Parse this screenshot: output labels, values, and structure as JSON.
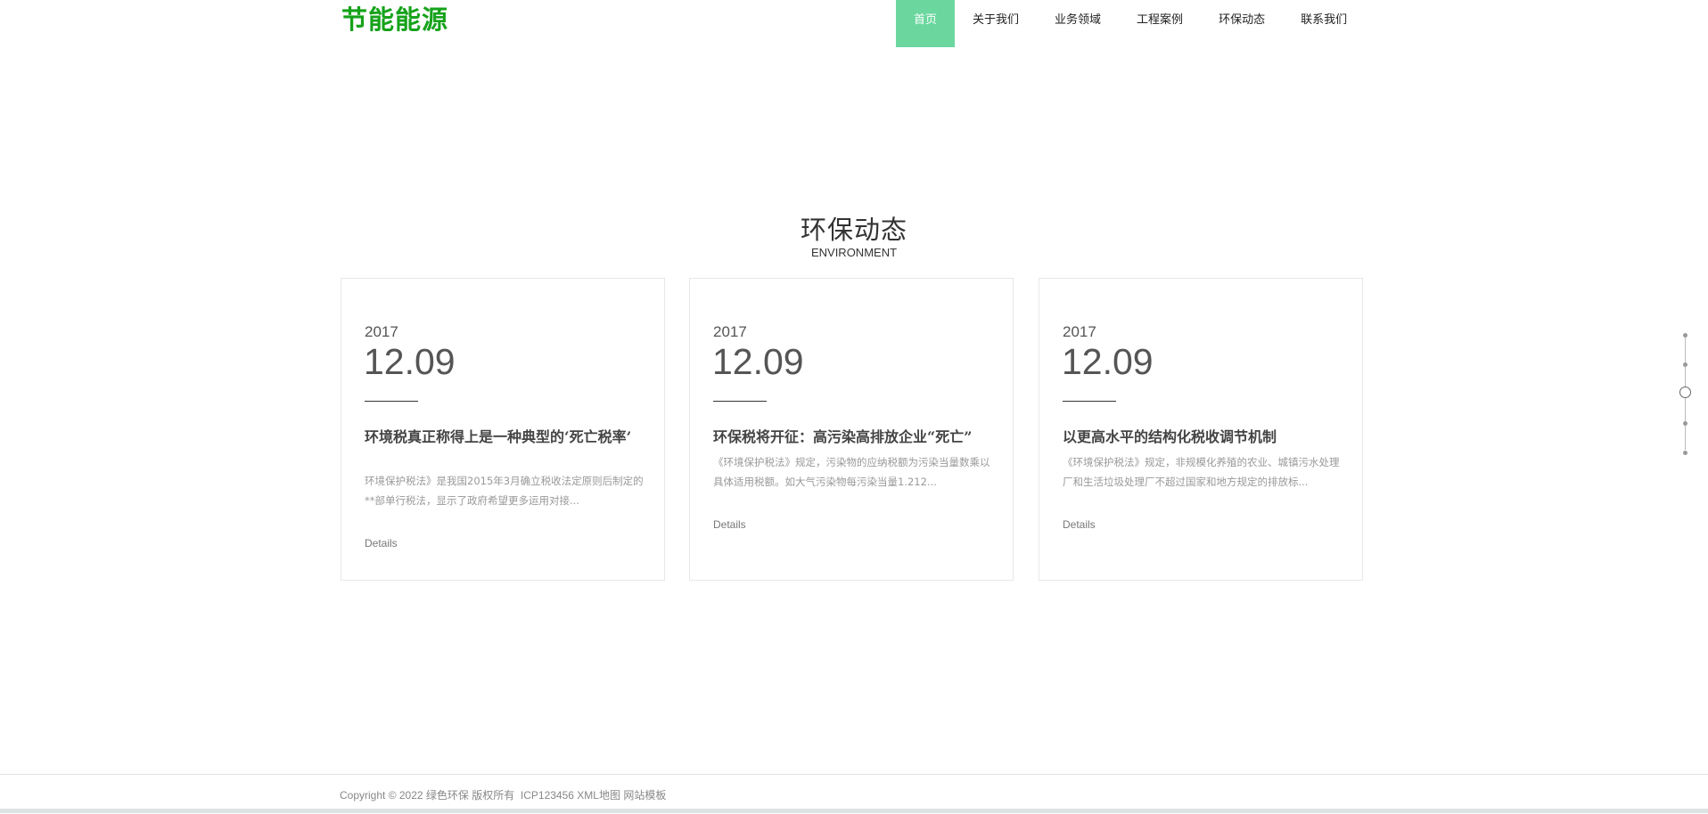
{
  "header": {
    "logo": "节能能源",
    "nav": [
      {
        "label": "首页",
        "active": true
      },
      {
        "label": "关于我们"
      },
      {
        "label": "业务领域"
      },
      {
        "label": "工程案例"
      },
      {
        "label": "环保动态"
      },
      {
        "label": "联系我们"
      }
    ],
    "active_color": "#6bd79f",
    "logo_color": "#16a21b"
  },
  "section": {
    "title": "环保动态",
    "subtitle": "ENVIRONMENT"
  },
  "cards": [
    {
      "year": "2017",
      "date": "12.09",
      "title": "环境税真正称得上是一种典型的‘死亡税率’",
      "desc": "环境保护税法》是我国2015年3月确立税收法定原则后制定的**部单行税法，显示了政府希望更多运用对接...",
      "details": "Details"
    },
    {
      "year": "2017",
      "date": "12.09",
      "title": "环保税将开征：高污染高排放企业“死亡”",
      "desc": "《环境保护税法》规定，污染物的应纳税额为污染当量数乘以具体适用税额。如大气污染物每污染当量1.212...",
      "details": "Details"
    },
    {
      "year": "2017",
      "date": "12.09",
      "title": "以更高水平的结构化税收调节机制",
      "desc": "《环境保护税法》规定，非规模化养殖的农业、城镇污水处理厂和生活垃圾处理厂不超过国家和地方规定的排放标...",
      "details": "Details"
    }
  ],
  "pager": {
    "count": 5,
    "active_index": 2
  },
  "footer": {
    "copyright": "Copyright © 2022 绿色环保 版权所有",
    "icp": "ICP123456",
    "xml": "XML地图",
    "template": "网站模板"
  }
}
